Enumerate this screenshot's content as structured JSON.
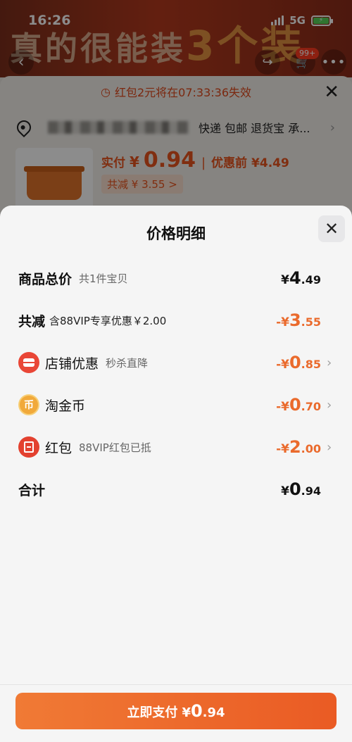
{
  "status_bar": {
    "time": "16:26",
    "network": "5G"
  },
  "background": {
    "banner_text_a": "真的很能装",
    "banner_text_b": "3个装",
    "cart_badge": "99+",
    "promo_text": "红包2元将在07:33:36失效",
    "address_tags": "快递 包邮 退货宝 承...",
    "price": {
      "label": "实付",
      "currency": "¥",
      "value": "0.94",
      "before_label": "优惠前",
      "before_value": "¥4.49"
    },
    "reduce_tag": "共减 ¥ 3.55 >"
  },
  "sheet": {
    "title": "价格明细",
    "rows": [
      {
        "label": "商品总价",
        "sub": "共1件宝贝",
        "currency": "¥",
        "int": "4",
        "dec": ".49"
      },
      {
        "label": "共减",
        "sub": "含88VIP专享优惠￥2.00",
        "currency": "-¥",
        "int": "3",
        "dec": ".55"
      },
      {
        "label": "店铺优惠",
        "sub": "秒杀直降",
        "currency": "-¥",
        "int": "0",
        "dec": ".85"
      },
      {
        "label": "淘金币",
        "sub": "",
        "currency": "-¥",
        "int": "0",
        "dec": ".70"
      },
      {
        "label": "红包",
        "sub": "88VIP红包已抵",
        "currency": "-¥",
        "int": "2",
        "dec": ".00"
      },
      {
        "label": "合计",
        "sub": "",
        "currency": "¥",
        "int": "0",
        "dec": ".94"
      }
    ],
    "pay_button": {
      "label": "立即支付",
      "currency": "¥",
      "int": "0",
      "dec": ".94"
    }
  },
  "colors": {
    "accent": "#ea6a2c",
    "button": "#ea5b24"
  },
  "icons": [
    "back-icon",
    "share-icon",
    "cart-icon",
    "more-icon",
    "clock-icon",
    "close-icon",
    "location-icon",
    "shop-icon",
    "coin-icon",
    "red-packet-icon",
    "chevron-right-icon"
  ]
}
